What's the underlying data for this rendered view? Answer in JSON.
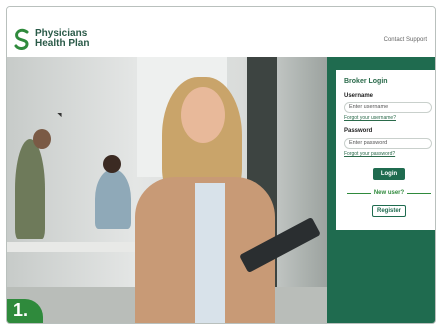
{
  "header": {
    "logo_line1": "Physicians",
    "logo_line2": "Health Plan",
    "contact_link": "Contact Support"
  },
  "badge": {
    "label": "1."
  },
  "login": {
    "title": "Broker Login",
    "username_label": "Username",
    "username_placeholder": "Enter username",
    "forgot_username": "Forgot your username?",
    "password_label": "Password",
    "password_placeholder": "Enter password",
    "forgot_password": "Forgot your password?",
    "login_button": "Login",
    "new_user_text": "New user?",
    "register_button": "Register"
  },
  "colors": {
    "brand_green": "#1f6b4f",
    "accent_green": "#2f8a3c"
  },
  "icons": {
    "logo": "physicians-health-plan-logo-icon",
    "cursor": "mouse-cursor-icon"
  }
}
